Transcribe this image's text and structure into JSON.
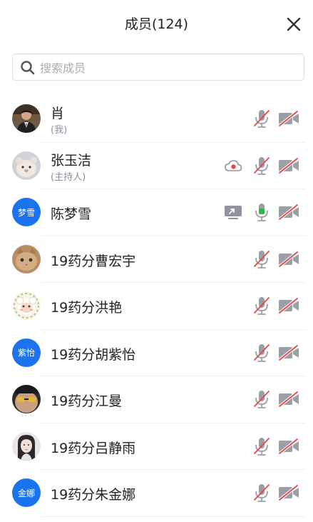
{
  "header": {
    "title": "成员(124)"
  },
  "search": {
    "placeholder": "搜索成员",
    "value": ""
  },
  "members": [
    {
      "name": "肖",
      "subtitle": "(我)",
      "avatar": "photo-man-suit",
      "mic": "muted",
      "camera": "off"
    },
    {
      "name": "张玉洁",
      "subtitle": "(主持人)",
      "avatar": "photo-plush-toy",
      "extra_icon": "cloud-record-icon",
      "mic": "muted",
      "camera": "off"
    },
    {
      "name": "陈梦雪",
      "avatar_text": "梦雪",
      "extra_icon": "screen-share-icon",
      "mic": "active",
      "camera": "off"
    },
    {
      "name": "19药分曹宏宇",
      "avatar": "photo-cat",
      "mic": "muted",
      "camera": "off"
    },
    {
      "name": "19药分洪艳",
      "avatar": "photo-cartoon-sheep",
      "mic": "muted",
      "camera": "off"
    },
    {
      "name": "19药分胡紫怡",
      "avatar_text": "紫怡",
      "mic": "muted",
      "camera": "off"
    },
    {
      "name": "19药分江曼",
      "avatar": "photo-sunglasses",
      "mic": "muted",
      "camera": "off"
    },
    {
      "name": "19药分吕静雨",
      "avatar": "photo-girl",
      "mic": "muted",
      "camera": "off"
    },
    {
      "name": "19药分朱金娜",
      "avatar_text": "金娜",
      "mic": "muted",
      "camera": "off"
    }
  ],
  "colors": {
    "accent": "#1b74ee",
    "muted_red": "#e54646",
    "icon_gray": "#9aa0a8",
    "mic_active": "#36b34a"
  }
}
